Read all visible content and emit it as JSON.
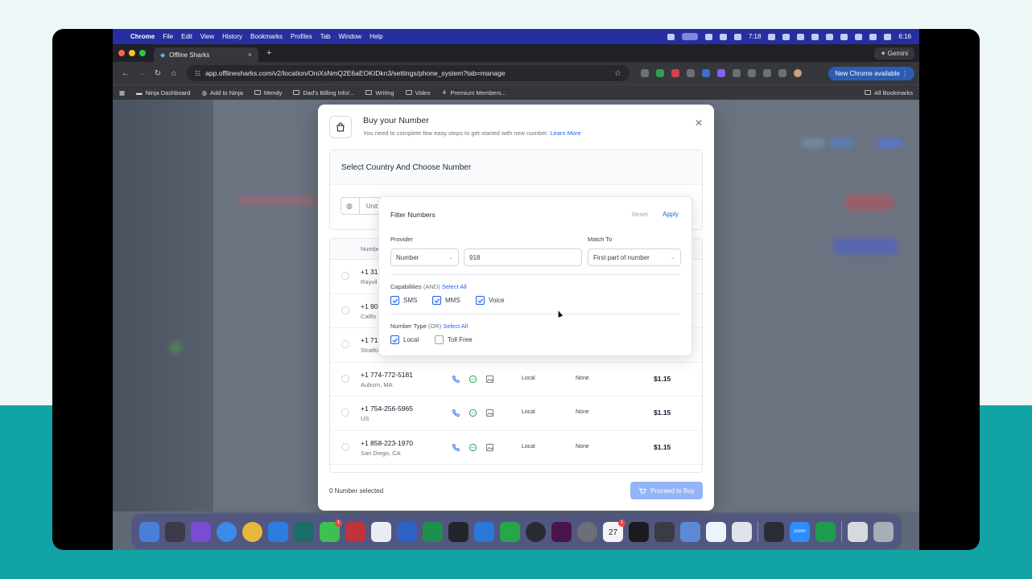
{
  "menubar": {
    "app": "Chrome",
    "items": [
      "File",
      "Edit",
      "View",
      "History",
      "Bookmarks",
      "Profiles",
      "Tab",
      "Window",
      "Help"
    ],
    "timer": "7:18",
    "clock": "6:16"
  },
  "browser": {
    "tab_title": "Offline Sharks",
    "url": "app.offlinesharks.com/v2/location/OniXsNmQ2E6aEOKIDkn3/settings/phone_system?tab=manage",
    "gemini": "Gemini",
    "new_chrome": "New Chrome available",
    "bookmarks": [
      "Ninja Dashboard",
      "Add to Ninja",
      "Mendy",
      "Dad's Billing Info/...",
      "Writing",
      "Video",
      "Premium Members..."
    ],
    "all_bookmarks": "All Bookmarks"
  },
  "modal": {
    "title": "Buy your Number",
    "subtitle": "You need to complete few easy steps to get started with new number.",
    "learn_more": "Learn More",
    "section_title": "Select Country And Choose Number",
    "country_value": "Unit",
    "table_header_number": "Number",
    "rows_hidden": [
      {
        "number": "+1 31",
        "location": "Rayvil"
      },
      {
        "number": "+1 90",
        "location": "Califo"
      },
      {
        "number": "+1 71",
        "location": "Stratfo"
      }
    ],
    "rows": [
      {
        "number": "+1 774-772-5181",
        "location": "Auburn, MA",
        "type": "Local",
        "address": "None",
        "price": "$1.15"
      },
      {
        "number": "+1 754-256-5965",
        "location": "US",
        "type": "Local",
        "address": "None",
        "price": "$1.15"
      },
      {
        "number": "+1 858-223-1970",
        "location": "San Diego, CA",
        "type": "Local",
        "address": "None",
        "price": "$1.15"
      }
    ],
    "selected_count": "0 Number selected",
    "proceed": "Proceed to Buy"
  },
  "filter": {
    "title": "Filter Numbers",
    "reset": "Reset",
    "apply": "Apply",
    "provider_label": "Provider",
    "provider_value": "Number",
    "number_value": "918",
    "match_label": "Match To",
    "match_value": "First part of number",
    "capabilities_label": "Capabilities",
    "capabilities_mode": "(AND)",
    "select_all": "Select All",
    "capabilities": [
      {
        "label": "SMS",
        "checked": true
      },
      {
        "label": "MMS",
        "checked": true
      },
      {
        "label": "Voice",
        "checked": true
      }
    ],
    "number_type_label": "Number Type",
    "number_type_mode": "(OR)",
    "number_types": [
      {
        "label": "Local",
        "checked": true
      },
      {
        "label": "Toll Free",
        "checked": false
      }
    ]
  },
  "dock": {
    "badges": [
      "1",
      "1"
    ],
    "calendar_day": "27",
    "zoom_label": "zoom"
  },
  "colors": {
    "accent": "#2563eb",
    "proceed": "#93b4f6",
    "teal": "#12a3a5",
    "menubar": "#262fa0"
  }
}
